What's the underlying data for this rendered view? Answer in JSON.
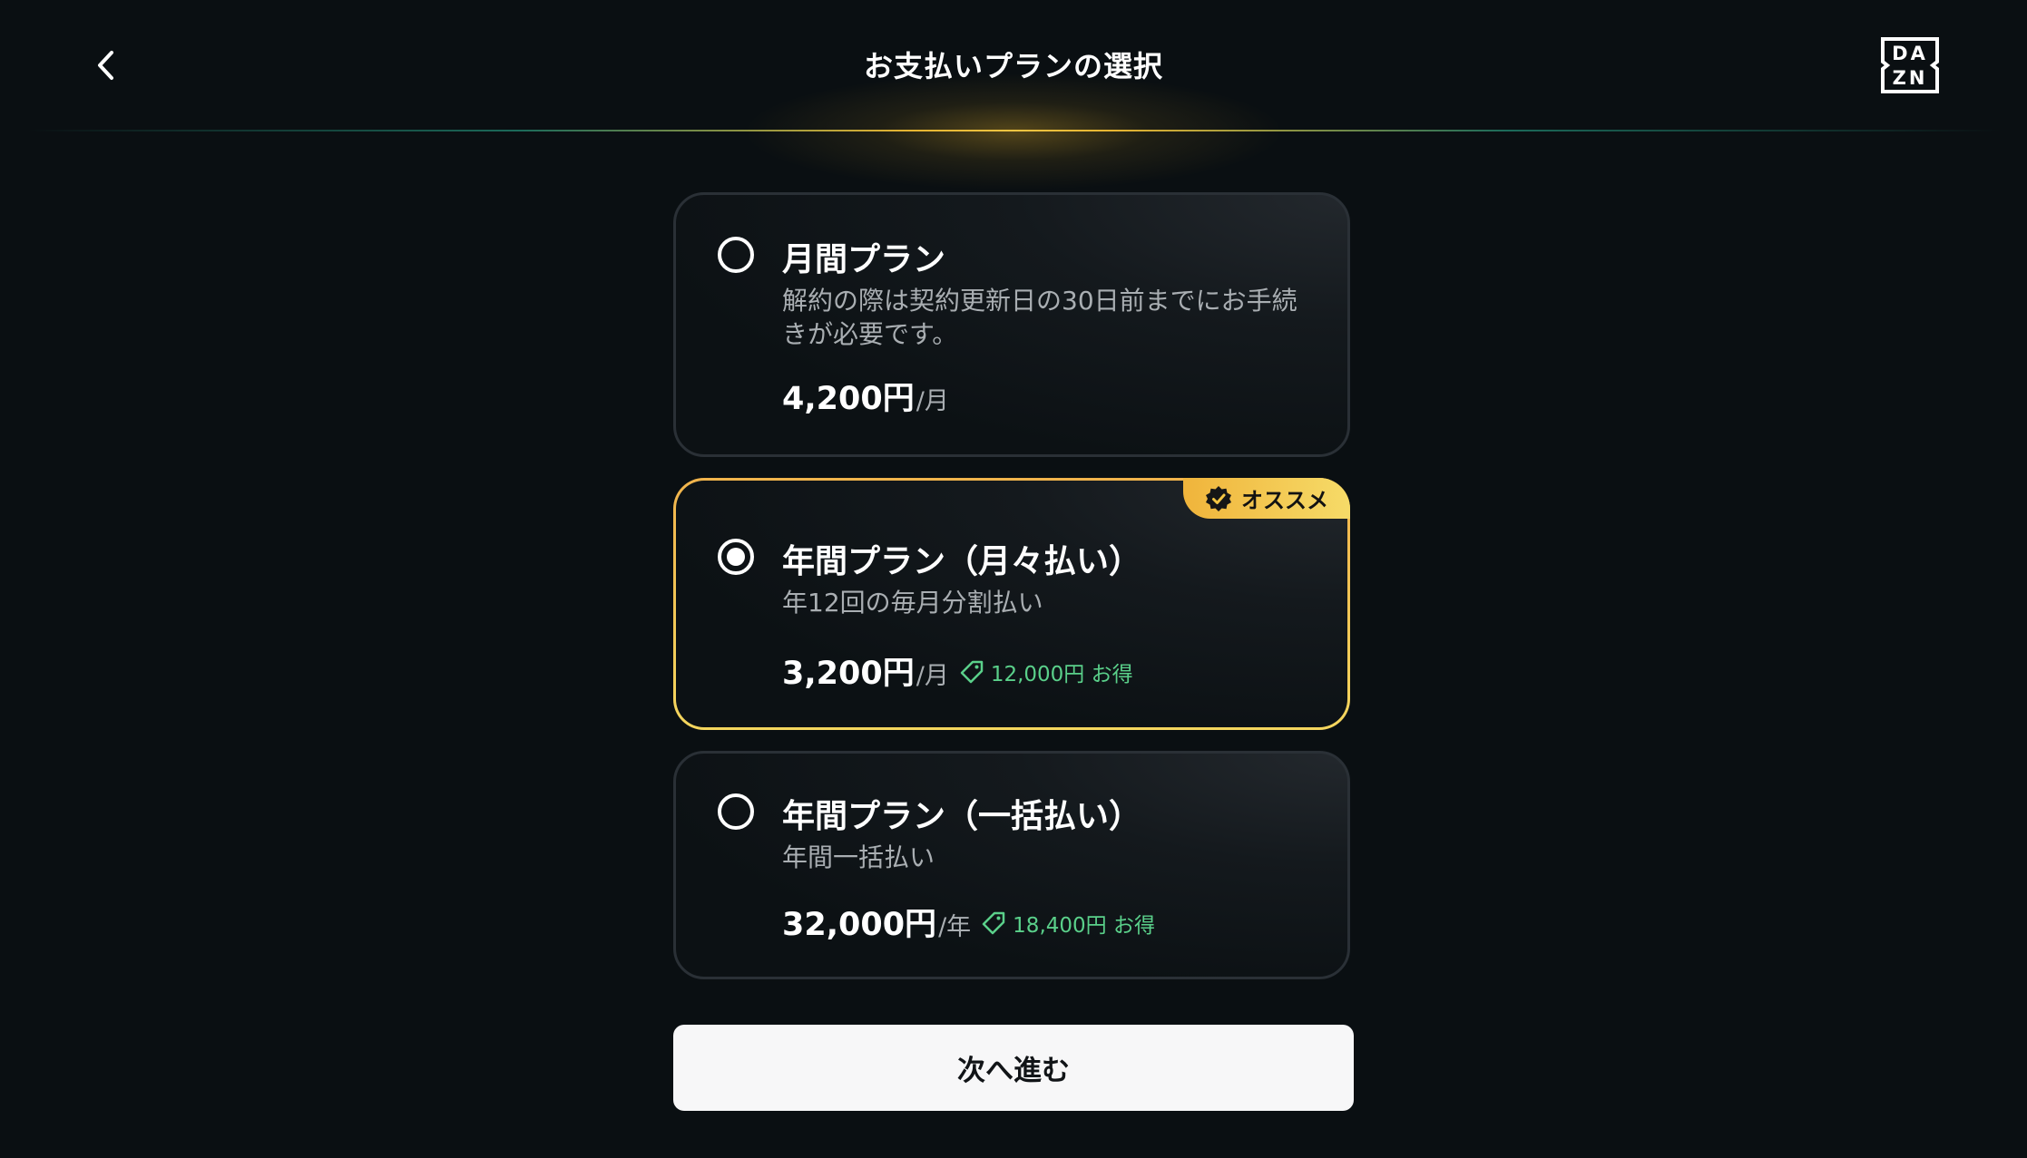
{
  "header": {
    "title": "お支払いプランの選択",
    "back_icon": "chevron-left-icon",
    "logo_text_line1": "DA",
    "logo_text_line2": "ZN"
  },
  "plans": [
    {
      "name": "月間プラン",
      "description": "解約の際は契約更新日の30日前までにお手続きが必要です。",
      "price": "4,200円",
      "unit": "/月",
      "savings": "",
      "selected": false
    },
    {
      "name": "年間プラン（月々払い）",
      "description": "年12回の毎月分割払い",
      "price": "3,200円",
      "unit": "/月",
      "savings": "12,000円 お得",
      "selected": true,
      "badge": "オススメ"
    },
    {
      "name": "年間プラン（一括払い）",
      "description": "年間一括払い",
      "price": "32,000円",
      "unit": "/年",
      "savings": "18,400円 お得",
      "selected": false
    }
  ],
  "next_button": {
    "label": "次へ進む"
  },
  "colors": {
    "background": "#0a0f12",
    "accent_gold": "#f3c543",
    "savings_green": "#5ad08a",
    "button_bg": "#f7f7f8"
  }
}
